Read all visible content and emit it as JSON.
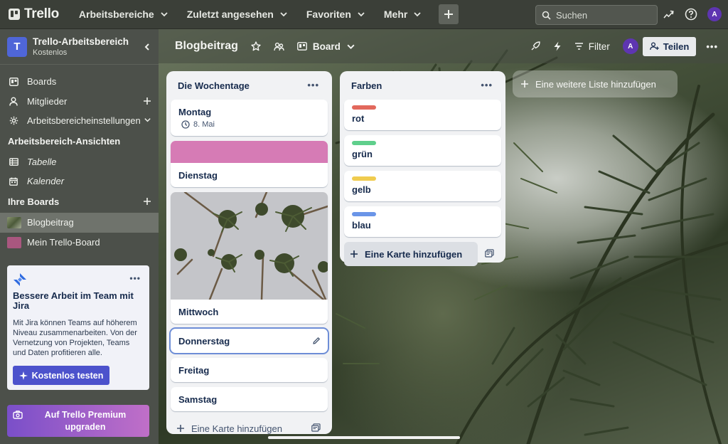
{
  "topbar": {
    "logo_text": "Trello",
    "menus": [
      {
        "label": "Arbeitsbereiche"
      },
      {
        "label": "Zuletzt angesehen"
      },
      {
        "label": "Favoriten"
      },
      {
        "label": "Mehr"
      }
    ],
    "search_placeholder": "Suchen",
    "avatar_initial": "A"
  },
  "sidebar": {
    "workspace_initial": "T",
    "workspace_name": "Trello-Arbeitsbereich",
    "workspace_plan": "Kostenlos",
    "items": [
      {
        "label": "Boards",
        "icon": "board-icon"
      },
      {
        "label": "Mitglieder",
        "icon": "members-icon"
      },
      {
        "label": "Arbeitsbereicheinstellungen",
        "icon": "gear-icon"
      }
    ],
    "views_heading": "Arbeitsbereich-Ansichten",
    "views": [
      {
        "label": "Tabelle",
        "icon": "table-icon"
      },
      {
        "label": "Kalender",
        "icon": "calendar-icon"
      }
    ],
    "boards_heading": "Ihre Boards",
    "boards": [
      {
        "label": "Blogbeitrag",
        "color": "#5f6b4c",
        "active": true
      },
      {
        "label": "Mein Trello-Board",
        "color": "#a9577f",
        "active": false
      }
    ],
    "promo": {
      "title": "Bessere Arbeit im Team mit Jira",
      "text": "Mit Jira können Teams auf höherem Niveau zusammenarbeiten. Von der Vernetzung von Projekten, Teams und Daten profitieren alle.",
      "button": "Kostenlos testen"
    },
    "premium_label": "Auf Trello Premium upgraden"
  },
  "board": {
    "title": "Blogbeitrag",
    "view_label": "Board",
    "filter_label": "Filter",
    "member_initial": "A",
    "share_label": "Teilen",
    "add_list_label": "Eine weitere Liste hinzufügen",
    "lists": [
      {
        "title": "Die Wochentage",
        "cards": [
          {
            "title": "Montag",
            "date": "8. Mai"
          },
          {
            "title": "Dienstag",
            "cover_color": "#d67bb5"
          },
          {
            "title": "Mittwoch",
            "cover": "palm-photo"
          },
          {
            "title": "Donnerstag"
          },
          {
            "title": "Freitag"
          },
          {
            "title": "Samstag"
          }
        ],
        "add_card_label": "Eine Karte hinzufügen"
      },
      {
        "title": "Farben",
        "cards": [
          {
            "title": "rot",
            "label_color": "#e2685c"
          },
          {
            "title": "grün",
            "label_color": "#5fcf8c"
          },
          {
            "title": "gelb",
            "label_color": "#f0cc4f"
          },
          {
            "title": "blau",
            "label_color": "#6a95e8"
          }
        ],
        "add_card_label": "Eine Karte hinzufügen"
      }
    ]
  },
  "colors": {
    "accent": "#4c52cc",
    "workspace_avatar": "#4f66d8",
    "member_avatar": "#5e35b1"
  }
}
